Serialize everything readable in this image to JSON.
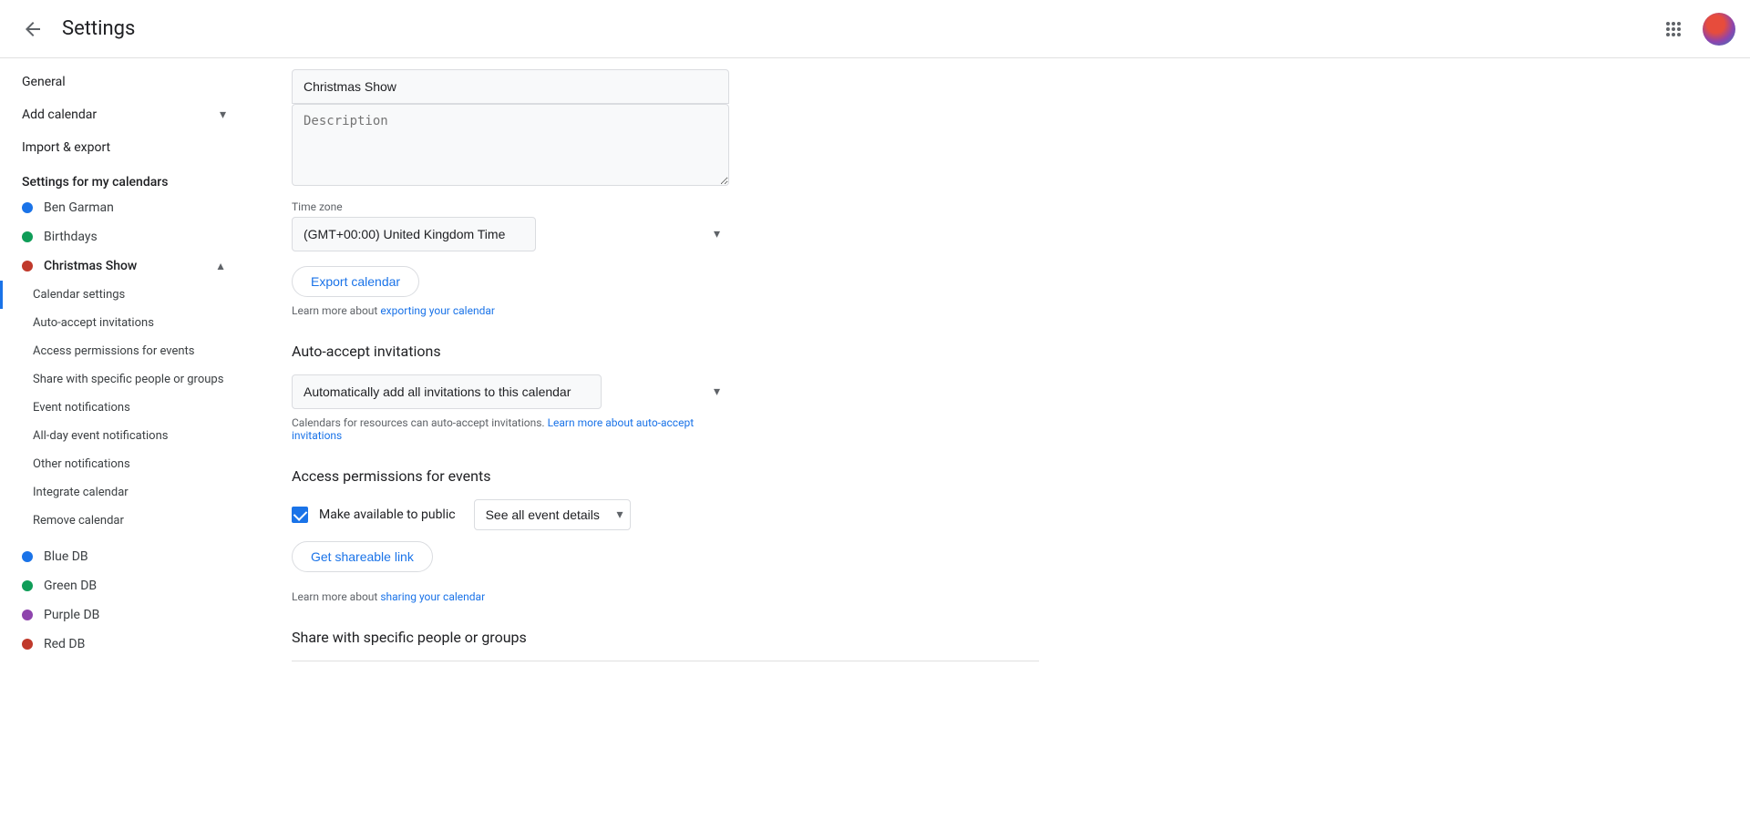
{
  "header": {
    "title": "Settings",
    "back_label": "Back"
  },
  "sidebar": {
    "general_label": "General",
    "add_calendar_label": "Add calendar",
    "import_export_label": "Import & export",
    "section_my_calendars": "Settings for my calendars",
    "calendars": [
      {
        "name": "Ben Garman",
        "color": "#1a73e8",
        "expanded": false
      },
      {
        "name": "Birthdays",
        "color": "#0f9d58",
        "expanded": false
      },
      {
        "name": "Christmas Show",
        "color": "#c0392b",
        "expanded": true,
        "sub_items": [
          "Calendar settings",
          "Auto-accept invitations",
          "Access permissions for events",
          "Share with specific people or groups",
          "Event notifications",
          "All-day event notifications",
          "Other notifications",
          "Integrate calendar",
          "Remove calendar"
        ]
      }
    ],
    "other_calendars": [
      {
        "name": "Blue DB",
        "color": "#1a73e8"
      },
      {
        "name": "Green DB",
        "color": "#0f9d58"
      },
      {
        "name": "Purple DB",
        "color": "#8e44ad"
      },
      {
        "name": "Red DB",
        "color": "#c0392b"
      }
    ]
  },
  "main": {
    "calendar_name_value": "Christmas Show",
    "description_placeholder": "Description",
    "timezone_label": "Time zone",
    "timezone_value": "(GMT+00:00) United Kingdom Time",
    "export_button": "Export calendar",
    "export_learn_more_text": "Learn more about ",
    "export_learn_more_link": "exporting your calendar",
    "auto_accept_section_title": "Auto-accept invitations",
    "auto_accept_option": "Automatically add all invitations to this calendar",
    "auto_accept_helper": "Calendars for resources can auto-accept invitations. ",
    "auto_accept_helper_link": "Learn more about auto-accept invitations",
    "access_section_title": "Access permissions for events",
    "make_public_label": "Make available to public",
    "see_all_details_option": "See all event details",
    "get_shareable_link_button": "Get shareable link",
    "sharing_learn_more_text": "Learn more about ",
    "sharing_learn_more_link": "sharing your calendar",
    "share_section_title": "Share with specific people or groups"
  },
  "active_sub_item": "Integrate calendar",
  "arrow_target": "Integrate calendar"
}
